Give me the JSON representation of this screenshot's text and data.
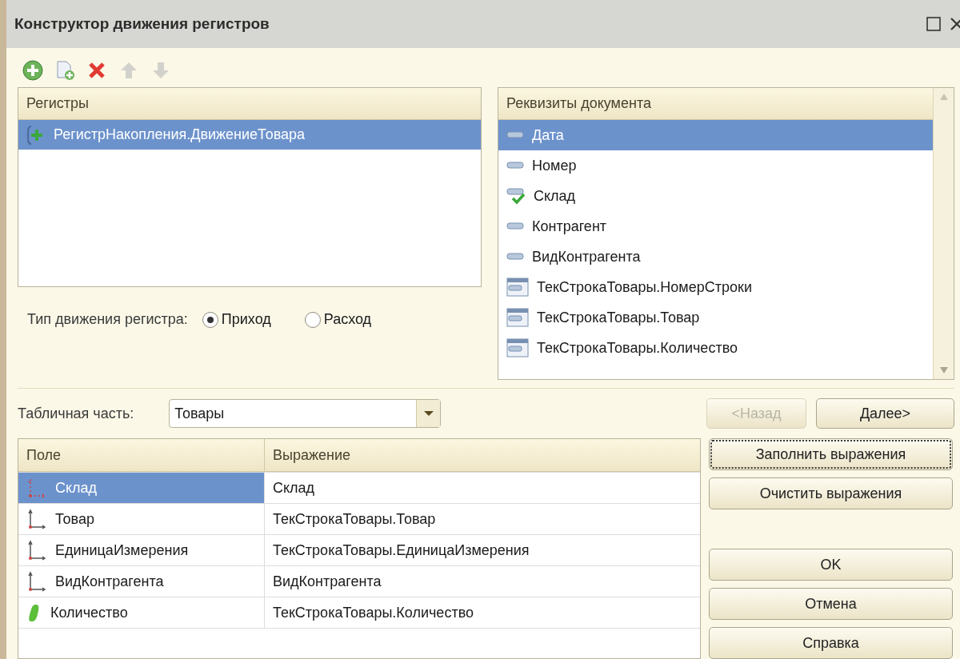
{
  "window": {
    "title": "Конструктор движения регистров"
  },
  "toolbar": [
    {
      "kind": "add",
      "disabled": false
    },
    {
      "kind": "copy",
      "disabled": false
    },
    {
      "kind": "delete",
      "disabled": false
    },
    {
      "kind": "up",
      "disabled": true
    },
    {
      "kind": "down",
      "disabled": true
    }
  ],
  "registers": {
    "header": "Регистры",
    "items": [
      {
        "label": "РегистрНакопления.ДвижениеТовара",
        "selected": true
      }
    ]
  },
  "movement_type": {
    "label": "Тип движения регистра:",
    "options": [
      {
        "label": "Приход",
        "selected": true
      },
      {
        "label": "Расход",
        "selected": false
      }
    ]
  },
  "attributes": {
    "header": "Реквизиты документа",
    "items": [
      {
        "label": "Дата",
        "kind": "attribute",
        "selected": true
      },
      {
        "label": "Номер",
        "kind": "attribute",
        "selected": false
      },
      {
        "label": "Склад",
        "kind": "used_attribute",
        "selected": false
      },
      {
        "label": "Контрагент",
        "kind": "attribute",
        "selected": false
      },
      {
        "label": "ВидКонтрагента",
        "kind": "attribute",
        "selected": false
      },
      {
        "label": "ТекСтрокаТовары.НомерСтроки",
        "kind": "table_attribute",
        "selected": false
      },
      {
        "label": "ТекСтрокаТовары.Товар",
        "kind": "table_attribute",
        "selected": false
      },
      {
        "label": "ТекСтрокаТовары.Количество",
        "kind": "table_attribute",
        "selected": false
      }
    ]
  },
  "table_part": {
    "label": "Табличная часть:",
    "value": "Товары"
  },
  "nav_buttons": [
    {
      "label": "<Назад",
      "disabled": true
    },
    {
      "label": "Далее>",
      "disabled": false
    }
  ],
  "fields_table": {
    "columns": [
      "Поле",
      "Выражение"
    ],
    "rows": [
      {
        "field": "Склад",
        "expression": "Склад",
        "kind": "dimension_filled",
        "selected": true
      },
      {
        "field": "Товар",
        "expression": "ТекСтрокаТовары.Товар",
        "kind": "dimension",
        "selected": false
      },
      {
        "field": "ЕдиницаИзмерения",
        "expression": "ТекСтрокаТовары.ЕдиницаИзмерения",
        "kind": "dimension",
        "selected": false
      },
      {
        "field": "ВидКонтрагента",
        "expression": "ВидКонтрагента",
        "kind": "dimension",
        "selected": false
      },
      {
        "field": "Количество",
        "expression": "ТекСтрокаТовары.Количество",
        "kind": "resource",
        "selected": false
      }
    ]
  },
  "action_buttons": [
    {
      "label": "Заполнить выражения",
      "focused": true
    },
    {
      "label": "Очистить выражения",
      "focused": false
    }
  ],
  "dialog_buttons": [
    {
      "label": "OK"
    },
    {
      "label": "Отмена"
    },
    {
      "label": "Справка"
    }
  ]
}
